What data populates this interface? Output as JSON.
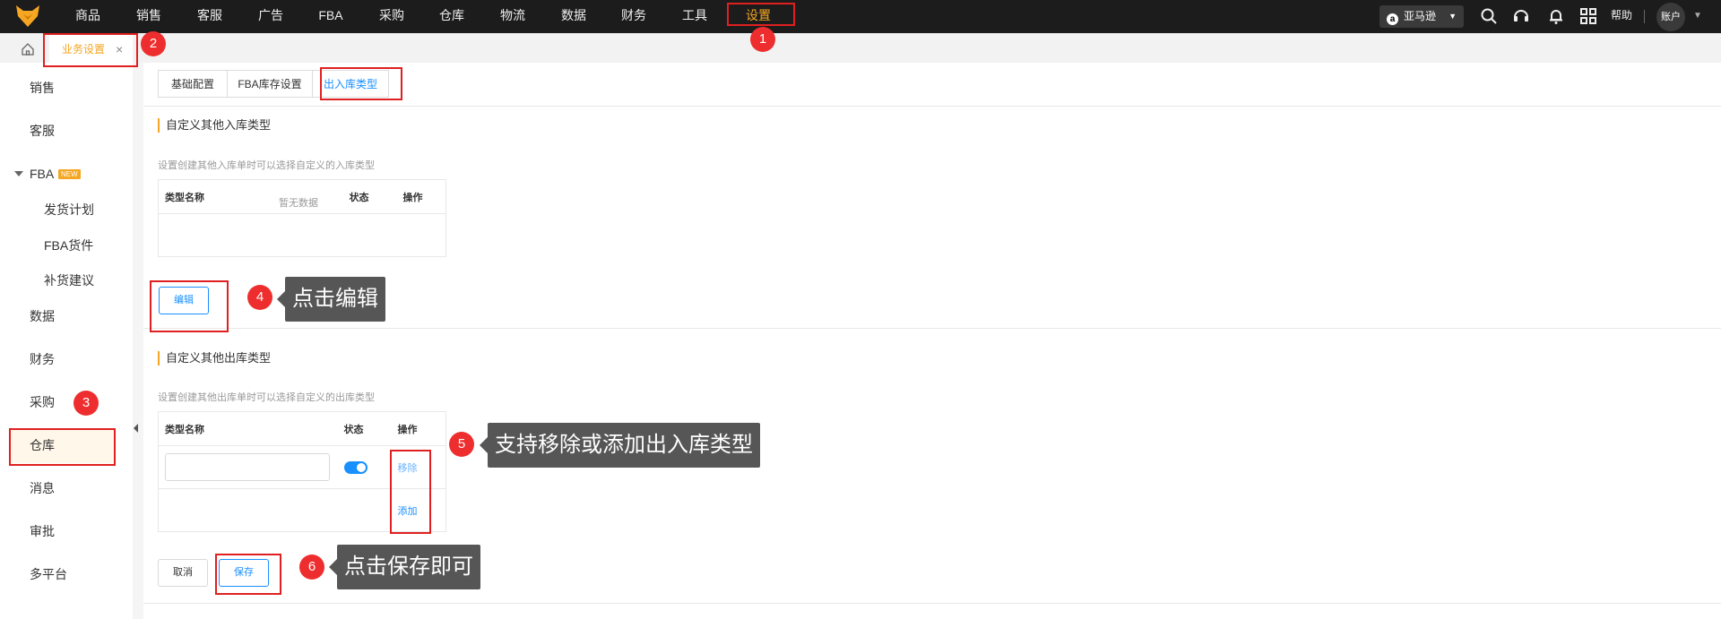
{
  "topnav": {
    "items": [
      "商品",
      "销售",
      "客服",
      "广告",
      "FBA",
      "采购",
      "仓库",
      "物流",
      "数据",
      "财务",
      "工具",
      "设置"
    ],
    "active_item": "设置",
    "store_selector": "亚马逊",
    "store_icon": "a",
    "help": "帮助",
    "account": "账户",
    "icons": [
      "search-icon",
      "headset-icon",
      "bell-icon",
      "apps-grid-icon"
    ]
  },
  "tabs": {
    "page_tab": "业务设置",
    "close": "×"
  },
  "sidebar": {
    "items": {
      "sales": "销售",
      "service": "客服",
      "fba": "FBA",
      "fba_badge": "NEW",
      "fba_sub": [
        "发货计划",
        "FBA货件",
        "补货建议"
      ],
      "data": "数据",
      "finance": "财务",
      "purchase": "采购",
      "warehouse": "仓库",
      "message": "消息",
      "approval": "审批",
      "multiplatform": "多平台"
    },
    "active": "仓库"
  },
  "subtabs": [
    "基础配置",
    "FBA库存设置",
    "出入库类型"
  ],
  "active_subtab": "出入库类型",
  "inbound": {
    "title": "自定义其他入库类型",
    "hint": "设置创建其他入库单时可以选择自定义的入库类型",
    "columns": [
      "类型名称",
      "状态",
      "操作"
    ],
    "empty_text": "暂无数据",
    "edit_button": "编辑"
  },
  "outbound": {
    "title": "自定义其他出库类型",
    "hint": "设置创建其他出库单时可以选择自定义的出库类型",
    "columns": [
      "类型名称",
      "状态",
      "操作"
    ],
    "row": {
      "name_value": "",
      "status_enabled": true,
      "remove": "移除"
    },
    "add": "添加",
    "cancel_button": "取消",
    "save_button": "保存"
  },
  "annotations": {
    "numbers": [
      "1",
      "2",
      "3",
      "4",
      "5",
      "6"
    ],
    "callouts": {
      "edit": "点击编辑",
      "add_remove": "支持移除或添加出入库类型",
      "save": "点击保存即可"
    },
    "colors": {
      "marker": "#ee2e2e",
      "callout_bg": "#565656",
      "accent": "#f5a623",
      "link": "#1890ff"
    }
  }
}
